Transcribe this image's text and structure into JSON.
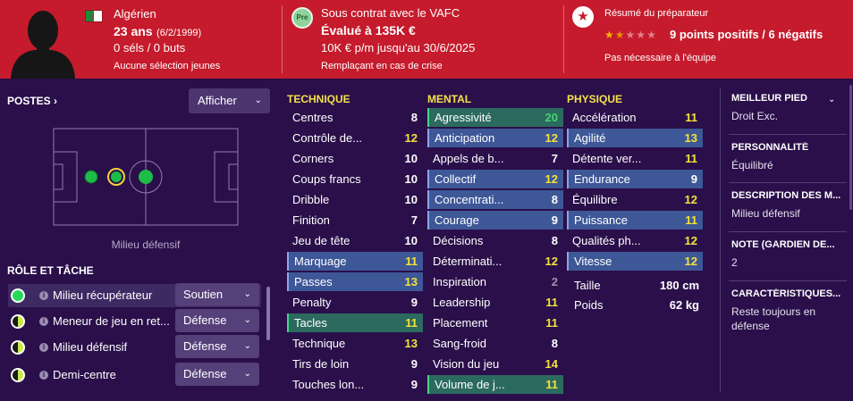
{
  "header": {
    "nationality": "Algérien",
    "age": "23 ans",
    "birthdate": "(6/2/1999)",
    "caps_goals": "0 séls / 0 buts",
    "youth_selection": "Aucune sélection jeunes",
    "contract_badge": "Pre",
    "contract": "Sous contrat avec le VAFC",
    "value": "Évalué à 135K €",
    "wage": "10K € p/m jusqu'au 30/6/2025",
    "squad_role": "Remplaçant en cas de crise",
    "coach_title": "Résumé du préparateur",
    "star_rating": 1.5,
    "coach_summary": "9 points positifs / 6 négatifs",
    "coach_note": "Pas nécessaire à l'équipe"
  },
  "positions": {
    "title": "POSTES",
    "show_button": "Afficher",
    "caption": "Milieu défensif"
  },
  "roles": {
    "title": "RÔLE ET TÂCHE",
    "items": [
      {
        "name": "Milieu récupérateur",
        "duty": "Soutien",
        "rating": "full"
      },
      {
        "name": "Meneur de jeu en ret...",
        "duty": "Défense",
        "rating": "half"
      },
      {
        "name": "Milieu défensif",
        "duty": "Défense",
        "rating": "half"
      },
      {
        "name": "Demi-centre",
        "duty": "Défense",
        "rating": "half"
      }
    ]
  },
  "technique": {
    "title": "TECHNIQUE",
    "items": [
      {
        "name": "Centres",
        "value": "8",
        "color": "white",
        "hl": ""
      },
      {
        "name": "Contrôle de...",
        "value": "12",
        "color": "yellow",
        "hl": ""
      },
      {
        "name": "Corners",
        "value": "10",
        "color": "white",
        "hl": ""
      },
      {
        "name": "Coups francs",
        "value": "10",
        "color": "white",
        "hl": ""
      },
      {
        "name": "Dribble",
        "value": "10",
        "color": "white",
        "hl": ""
      },
      {
        "name": "Finition",
        "value": "7",
        "color": "white",
        "hl": ""
      },
      {
        "name": "Jeu de tête",
        "value": "10",
        "color": "white",
        "hl": ""
      },
      {
        "name": "Marquage",
        "value": "11",
        "color": "yellow",
        "hl": "blue"
      },
      {
        "name": "Passes",
        "value": "13",
        "color": "yellow",
        "hl": "blue"
      },
      {
        "name": "Penalty",
        "value": "9",
        "color": "white",
        "hl": ""
      },
      {
        "name": "Tacles",
        "value": "11",
        "color": "yellow",
        "hl": "green"
      },
      {
        "name": "Technique",
        "value": "13",
        "color": "yellow",
        "hl": ""
      },
      {
        "name": "Tirs de loin",
        "value": "9",
        "color": "white",
        "hl": ""
      },
      {
        "name": "Touches lon...",
        "value": "9",
        "color": "white",
        "hl": ""
      }
    ]
  },
  "mental": {
    "title": "MENTAL",
    "items": [
      {
        "name": "Agressivité",
        "value": "20",
        "color": "green",
        "hl": "green"
      },
      {
        "name": "Anticipation",
        "value": "12",
        "color": "yellow",
        "hl": "blue"
      },
      {
        "name": "Appels de b...",
        "value": "7",
        "color": "white",
        "hl": ""
      },
      {
        "name": "Collectif",
        "value": "12",
        "color": "yellow",
        "hl": "blue"
      },
      {
        "name": "Concentrati...",
        "value": "8",
        "color": "white",
        "hl": "blue"
      },
      {
        "name": "Courage",
        "value": "9",
        "color": "white",
        "hl": "blue"
      },
      {
        "name": "Décisions",
        "value": "8",
        "color": "white",
        "hl": ""
      },
      {
        "name": "Déterminati...",
        "value": "12",
        "color": "yellow",
        "hl": ""
      },
      {
        "name": "Inspiration",
        "value": "2",
        "color": "grey",
        "hl": ""
      },
      {
        "name": "Leadership",
        "value": "11",
        "color": "yellow",
        "hl": ""
      },
      {
        "name": "Placement",
        "value": "11",
        "color": "yellow",
        "hl": ""
      },
      {
        "name": "Sang-froid",
        "value": "8",
        "color": "white",
        "hl": ""
      },
      {
        "name": "Vision du jeu",
        "value": "14",
        "color": "yellow",
        "hl": ""
      },
      {
        "name": "Volume de j...",
        "value": "11",
        "color": "yellow",
        "hl": "green"
      }
    ]
  },
  "physique": {
    "title": "PHYSIQUE",
    "items": [
      {
        "name": "Accélération",
        "value": "11",
        "color": "yellow",
        "hl": ""
      },
      {
        "name": "Agilité",
        "value": "13",
        "color": "yellow",
        "hl": "blue"
      },
      {
        "name": "Détente ver...",
        "value": "11",
        "color": "yellow",
        "hl": ""
      },
      {
        "name": "Endurance",
        "value": "9",
        "color": "white",
        "hl": "blue"
      },
      {
        "name": "Équilibre",
        "value": "12",
        "color": "yellow",
        "hl": ""
      },
      {
        "name": "Puissance",
        "value": "11",
        "color": "yellow",
        "hl": "blue"
      },
      {
        "name": "Qualités ph...",
        "value": "12",
        "color": "yellow",
        "hl": ""
      },
      {
        "name": "Vitesse",
        "value": "12",
        "color": "yellow",
        "hl": "blue"
      }
    ],
    "height_label": "Taille",
    "height_value": "180 cm",
    "weight_label": "Poids",
    "weight_value": "62 kg"
  },
  "side_info": {
    "foot_title": "MEILLEUR PIED",
    "foot_value": "Droit Exc.",
    "personality_title": "PERSONNALITÉ",
    "personality_value": "Équilibré",
    "description_title": "DESCRIPTION DES M...",
    "description_value": "Milieu défensif",
    "gk_title": "NOTE (GARDIEN DE...",
    "gk_value": "2",
    "traits_title": "CARACTÉRISTIQUES...",
    "traits_value": "Reste toujours en défense"
  },
  "colors": {
    "header_red": "#c51b2c",
    "background": "#2a0f4a",
    "attr_yellow": "#f4e23a",
    "attr_green": "#45d36f"
  }
}
